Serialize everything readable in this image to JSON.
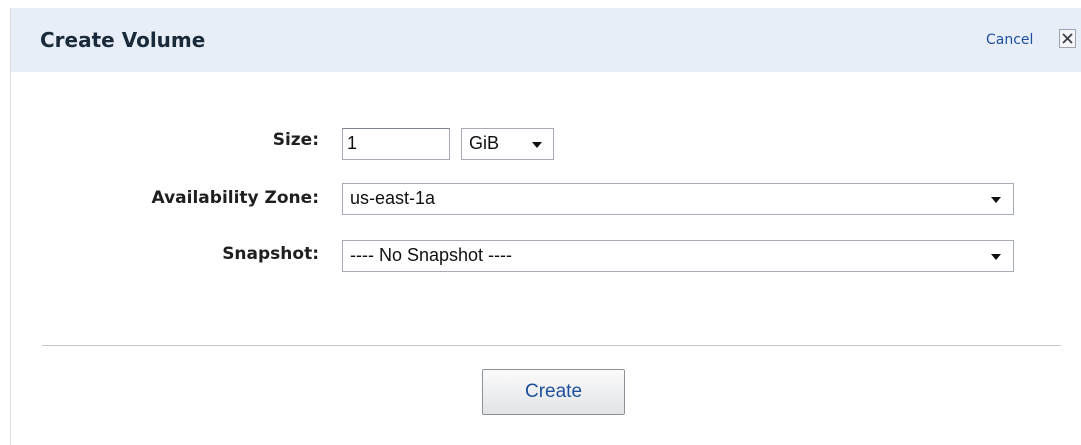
{
  "dialog": {
    "title": "Create Volume",
    "cancel_label": "Cancel",
    "close_icon": "close-x-icon"
  },
  "form": {
    "size": {
      "label": "Size:",
      "value": "1",
      "unit_selected": "GiB"
    },
    "availability_zone": {
      "label": "Availability Zone:",
      "selected": "us-east-1a"
    },
    "snapshot": {
      "label": "Snapshot:",
      "selected": "---- No Snapshot ----"
    }
  },
  "actions": {
    "create_label": "Create"
  },
  "colors": {
    "header_bg": "#e8eef8",
    "link": "#1d4f9a"
  }
}
